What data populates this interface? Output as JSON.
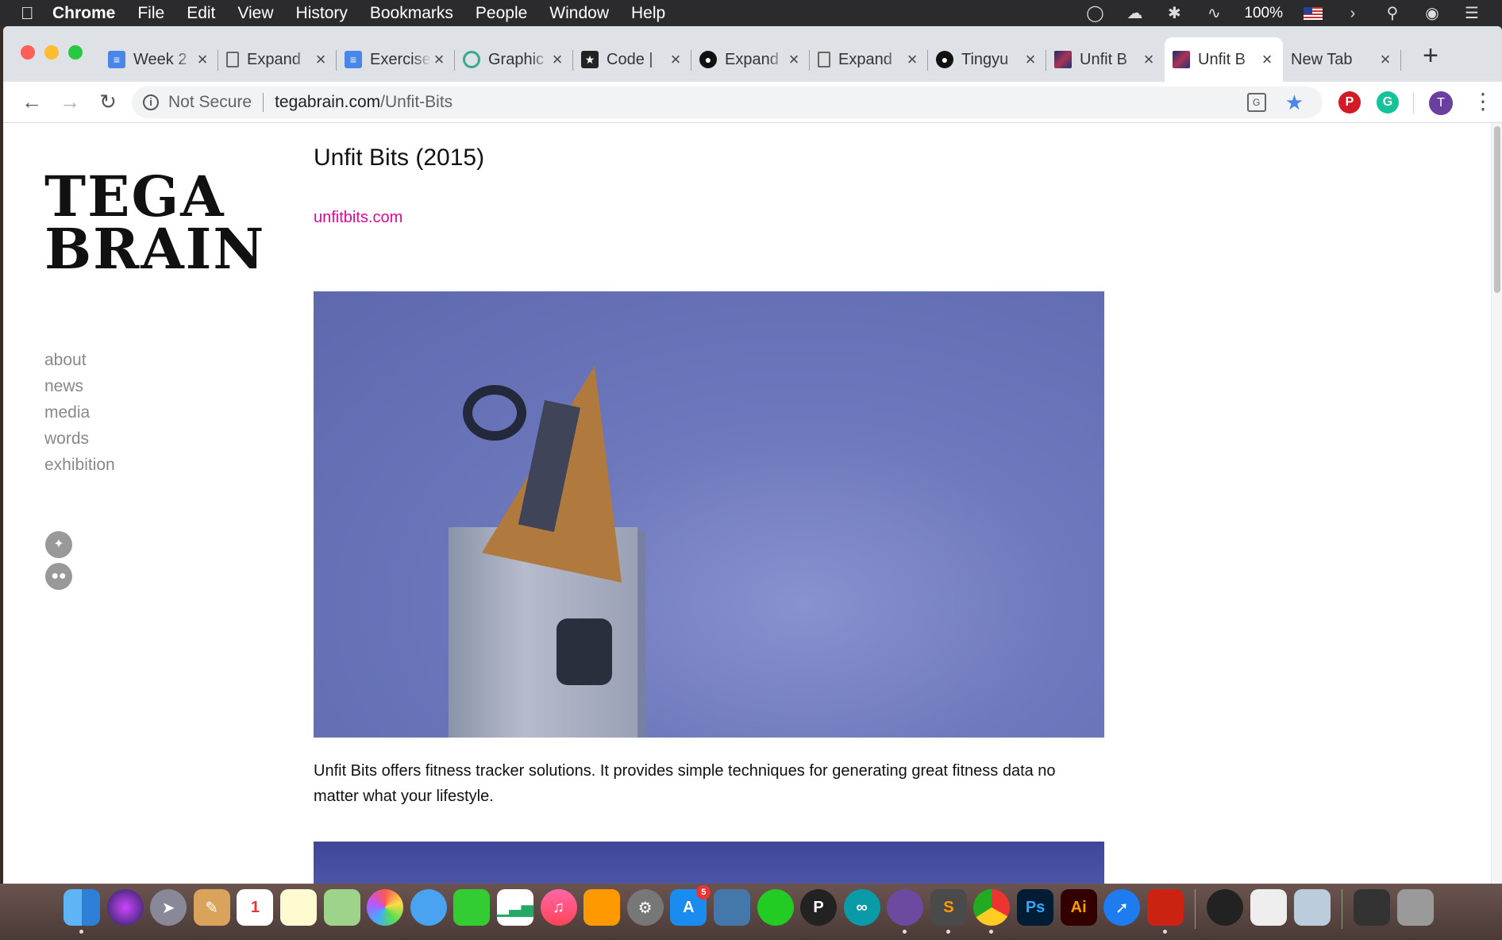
{
  "menubar": {
    "app": "Chrome",
    "items": [
      "File",
      "Edit",
      "View",
      "History",
      "Bookmarks",
      "People",
      "Window",
      "Help"
    ],
    "battery": "100%"
  },
  "tabs": [
    {
      "title": "Week 2",
      "icon": "google-docs-icon"
    },
    {
      "title": "Expand",
      "icon": "page-icon"
    },
    {
      "title": "Exercise",
      "icon": "google-docs-icon"
    },
    {
      "title": "Graphic",
      "icon": "ring-icon"
    },
    {
      "title": "Code |",
      "icon": "star-icon"
    },
    {
      "title": "Expand",
      "icon": "github-icon"
    },
    {
      "title": "Expand",
      "icon": "page-icon"
    },
    {
      "title": "Tingyu",
      "icon": "github-icon"
    },
    {
      "title": "Unfit B",
      "icon": "image-icon"
    },
    {
      "title": "Unfit B",
      "icon": "image-icon",
      "active": true
    },
    {
      "title": "New Tab",
      "icon": ""
    }
  ],
  "address": {
    "security": "Not Secure",
    "host": "tegabrain.com",
    "path": "/Unfit-Bits"
  },
  "profile": {
    "initial": "T"
  },
  "site": {
    "logo_line1": "TEGA",
    "logo_line2": "BRAIN",
    "nav": [
      "about",
      "news",
      "media",
      "words",
      "exhibition"
    ]
  },
  "article": {
    "title": "Unfit Bits (2015)",
    "link": "unfitbits.com",
    "description": "Unfit Bits offers fitness tracker solutions. It provides simple techniques for generating great fitness data no matter what your lifestyle."
  },
  "dock": {
    "app_store_badge": "5",
    "ai_label": "Ai",
    "ps_label": "Ps"
  }
}
